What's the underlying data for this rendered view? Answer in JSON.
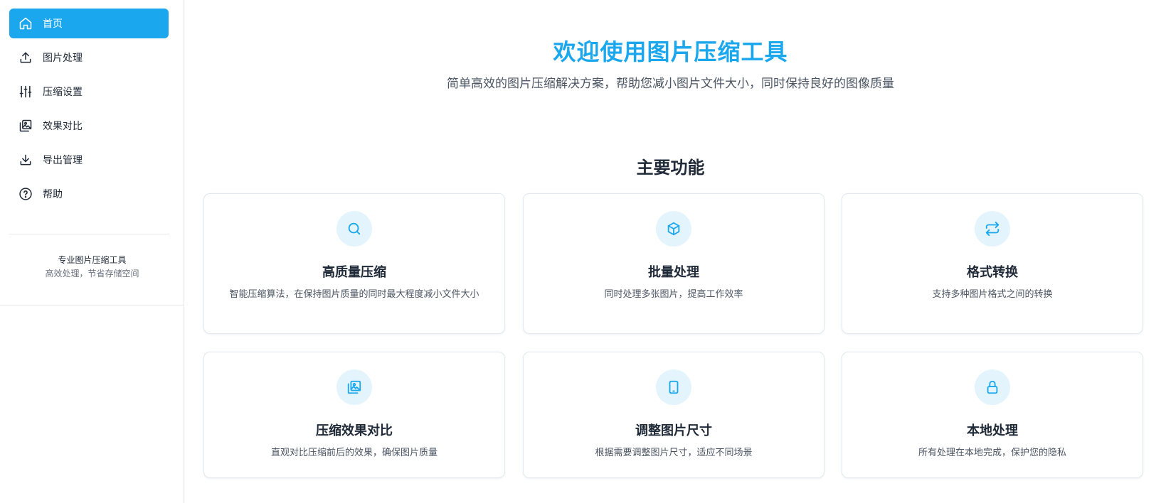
{
  "sidebar": {
    "items": [
      {
        "label": "首页",
        "icon": "home-icon",
        "active": true
      },
      {
        "label": "图片处理",
        "icon": "upload-icon",
        "active": false
      },
      {
        "label": "压缩设置",
        "icon": "sliders-icon",
        "active": false
      },
      {
        "label": "效果对比",
        "icon": "images-icon",
        "active": false
      },
      {
        "label": "导出管理",
        "icon": "download-icon",
        "active": false
      },
      {
        "label": "帮助",
        "icon": "help-circle-icon",
        "active": false
      }
    ],
    "footer": {
      "title": "专业图片压缩工具",
      "subtitle": "高效处理，节省存储空间"
    }
  },
  "main": {
    "title": "欢迎使用图片压缩工具",
    "subtitle": "简单高效的图片压缩解决方案，帮助您减小图片文件大小，同时保持良好的图像质量",
    "section_title": "主要功能",
    "features": [
      {
        "title": "高质量压缩",
        "desc": "智能压缩算法，在保持图片质量的同时最大程度减小文件大小",
        "icon": "search-icon"
      },
      {
        "title": "批量处理",
        "desc": "同时处理多张图片，提高工作效率",
        "icon": "package-icon"
      },
      {
        "title": "格式转换",
        "desc": "支持多种图片格式之间的转换",
        "icon": "repeat-icon"
      },
      {
        "title": "压缩效果对比",
        "desc": "直观对比压缩前后的效果，确保图片质量",
        "icon": "images-icon"
      },
      {
        "title": "调整图片尺寸",
        "desc": "根据需要调整图片尺寸，适应不同场景",
        "icon": "tablet-icon"
      },
      {
        "title": "本地处理",
        "desc": "所有处理在本地完成，保护您的隐私",
        "icon": "lock-icon"
      }
    ]
  },
  "colors": {
    "accent": "#1aa7ee",
    "icon_bg": "#e3f4fd",
    "text": "#1f2937",
    "muted": "#4b5563"
  }
}
